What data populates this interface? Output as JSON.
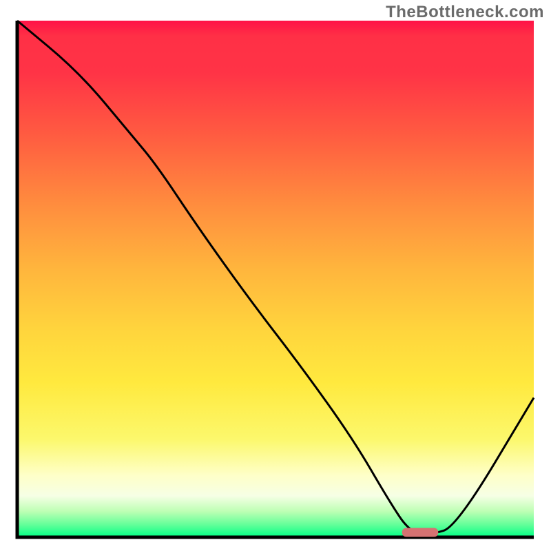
{
  "watermark": "TheBottleneck.com",
  "chart_data": {
    "type": "line",
    "title": "",
    "xlabel": "",
    "ylabel": "",
    "xlim": [
      0,
      100
    ],
    "ylim": [
      0,
      100
    ],
    "x": [
      0,
      12,
      22,
      27,
      35,
      45,
      55,
      65,
      72,
      76,
      80,
      85,
      100
    ],
    "values": [
      100,
      90,
      78,
      72,
      60,
      46,
      33,
      19,
      7,
      1,
      0.5,
      2,
      27
    ],
    "background": "bottleneck-gradient",
    "marker": {
      "x": 78,
      "y": 1,
      "width": 7,
      "color": "#d57272"
    },
    "annotations": []
  },
  "colors": {
    "gradient_top": "#ff1247",
    "gradient_mid": "#ffd53d",
    "gradient_bottom": "#00ff85",
    "curve": "#000000",
    "marker": "#d57272"
  }
}
